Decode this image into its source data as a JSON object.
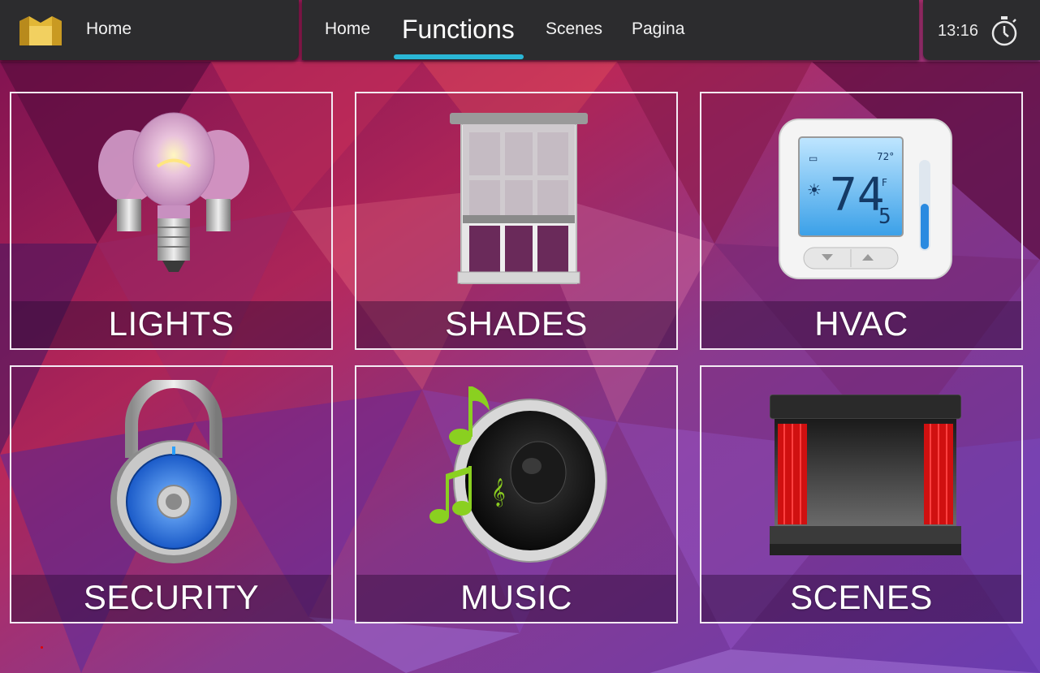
{
  "header": {
    "home_label": "Home",
    "nav": [
      {
        "label": "Home",
        "active": false
      },
      {
        "label": "Functions",
        "active": true
      },
      {
        "label": "Scenes",
        "active": false
      },
      {
        "label": "Pagina",
        "active": false
      }
    ],
    "clock": "13:16",
    "accent_color": "#2ab7d6"
  },
  "tiles": [
    {
      "label": "LIGHTS",
      "icon": "light-bulbs-icon"
    },
    {
      "label": "SHADES",
      "icon": "window-shade-icon"
    },
    {
      "label": "HVAC",
      "icon": "thermostat-icon"
    },
    {
      "label": "SECURITY",
      "icon": "padlock-icon"
    },
    {
      "label": "MUSIC",
      "icon": "speaker-icon"
    },
    {
      "label": "SCENES",
      "icon": "stage-icon"
    }
  ],
  "thermostat": {
    "temperature": "74",
    "decimal": "5",
    "unit": "F",
    "setpoint": "72°"
  }
}
